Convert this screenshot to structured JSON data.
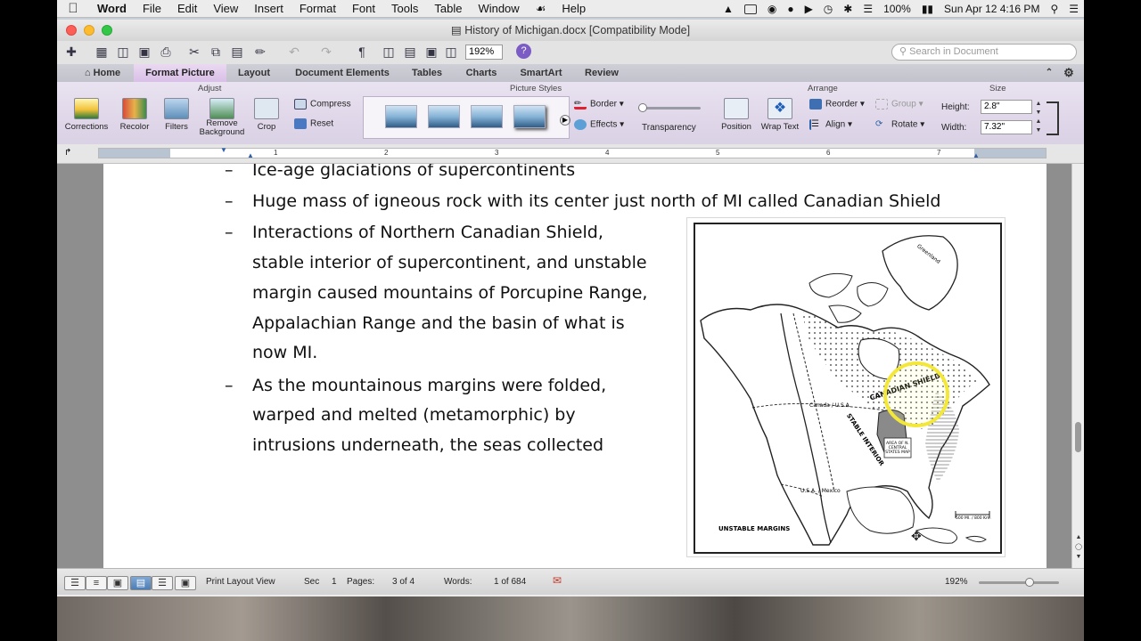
{
  "menubar": {
    "app": "Word",
    "items": [
      "File",
      "Edit",
      "View",
      "Insert",
      "Format",
      "Font",
      "Tools",
      "Table",
      "Window",
      "Help"
    ],
    "battery": "100%",
    "datetime": "Sun Apr 12  4:16 PM"
  },
  "window": {
    "title": "History of Michigan.docx [Compatibility Mode]"
  },
  "toolbar": {
    "zoom": "192%",
    "search_placeholder": "Search in Document"
  },
  "ribbon": {
    "tabs": [
      "Home",
      "Format Picture",
      "Layout",
      "Document Elements",
      "Tables",
      "Charts",
      "SmartArt",
      "Review"
    ],
    "active_tab": "Format Picture",
    "groups": {
      "adjust": "Adjust",
      "picture_styles": "Picture Styles",
      "arrange": "Arrange",
      "size": "Size"
    },
    "adjust_buttons": [
      "Corrections",
      "Recolor",
      "Filters",
      "Remove Background",
      "Crop"
    ],
    "compress": "Compress",
    "reset": "Reset",
    "border": "Border",
    "effects": "Effects",
    "transparency": "Transparency",
    "transparency_value": 0,
    "position": "Position",
    "wrap_text": "Wrap Text",
    "reorder": "Reorder",
    "group": "Group",
    "align": "Align",
    "rotate": "Rotate",
    "height_label": "Height:",
    "height_value": "2.8\"",
    "width_label": "Width:",
    "width_value": "7.32\""
  },
  "ruler": {
    "numbers": [
      "1",
      "2",
      "3",
      "4",
      "5",
      "6",
      "7"
    ]
  },
  "document": {
    "bullets": [
      "Ice-age glaciations of supercontinents",
      "Huge mass of igneous rock with its center just north of MI called Canadian Shield",
      "Interactions of Northern Canadian Shield,",
      "stable interior of supercontinent, and unstable",
      "margin caused mountains of Porcupine Range,",
      "Appalachian Range and the basin of what is",
      "now MI.",
      "As the mountainous margins were folded,",
      "warped and melted (metamorphic) by",
      "intrusions underneath, the seas collected"
    ],
    "dash": "–",
    "map_labels": {
      "greenland": "Greenland",
      "canadian_shield": "CANADIAN SHIELD",
      "canada_usa": "Canada / U.S.A.",
      "stable_interior": "STABLE INTERIOR",
      "usa_mexico": "U.S.A. / Mexico",
      "area_map": "AREA OF N. CENTRAL STATES MAP",
      "unstable_margins": "UNSTABLE MARGINS",
      "scale": "500 MI. / 800 Km."
    }
  },
  "statusbar": {
    "view": "Print Layout View",
    "sec_label": "Sec",
    "sec_value": "1",
    "pages_label": "Pages:",
    "pages_value": "3 of 4",
    "words_label": "Words:",
    "words_value": "1 of 684",
    "zoom": "192%"
  }
}
